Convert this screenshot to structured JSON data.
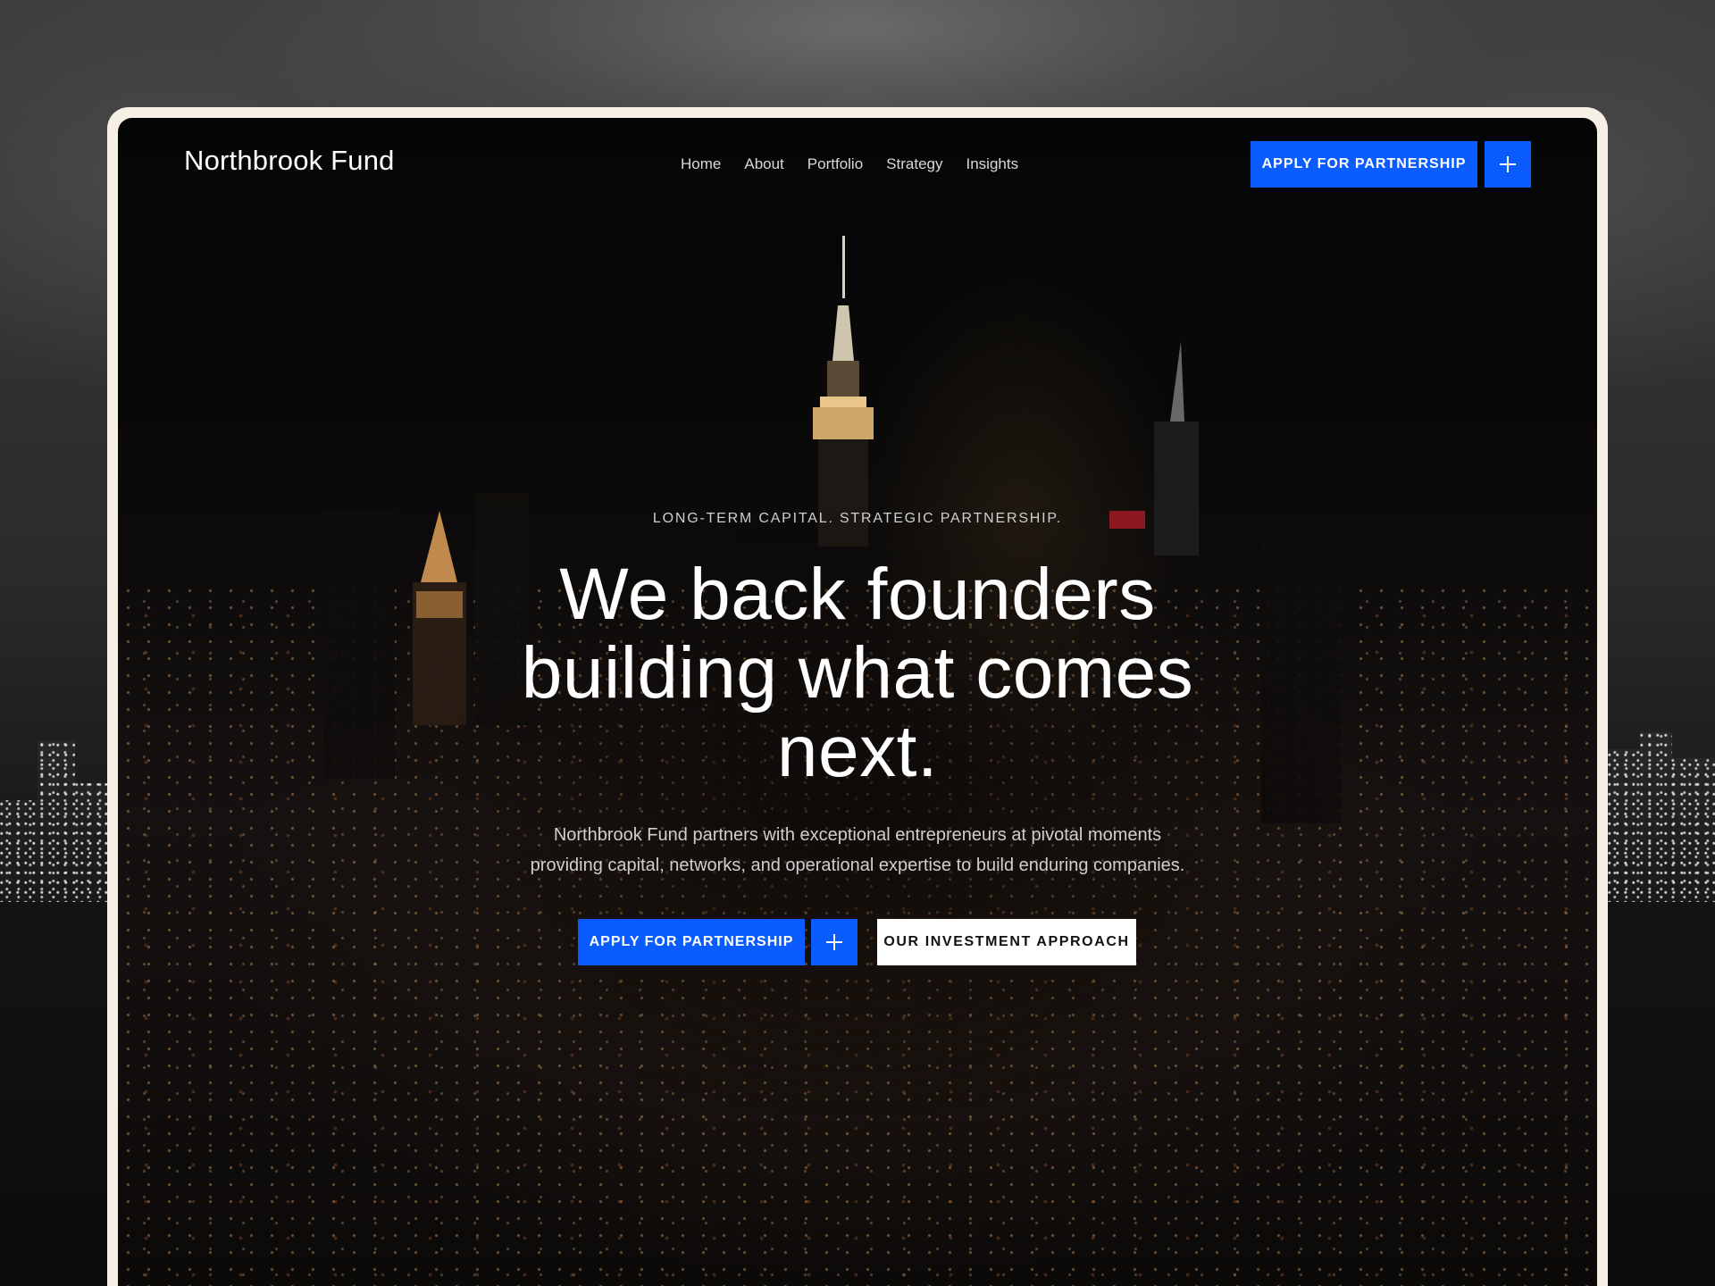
{
  "brand": {
    "name": "Northbrook Fund",
    "accent_color": "#0a5cff"
  },
  "nav": {
    "links": [
      {
        "label": "Home"
      },
      {
        "label": "About"
      },
      {
        "label": "Portfolio"
      },
      {
        "label": "Strategy"
      },
      {
        "label": "Insights"
      }
    ],
    "cta_label": "APPLY FOR PARTNERSHIP",
    "cta_icon": "plus-icon"
  },
  "hero": {
    "eyebrow": "LONG-TERM CAPITAL. STRATEGIC PARTNERSHIP.",
    "headline_lines": [
      "We back founders",
      "building what comes",
      "next."
    ],
    "subtext_lines": [
      "Northbrook Fund partners with exceptional entrepreneurs at pivotal moments",
      "providing capital, networks, and operational expertise to build enduring companies."
    ],
    "primary_cta_label": "APPLY FOR PARTNERSHIP",
    "primary_cta_icon": "plus-icon",
    "secondary_cta_label": "OUR INVESTMENT APPROACH"
  }
}
